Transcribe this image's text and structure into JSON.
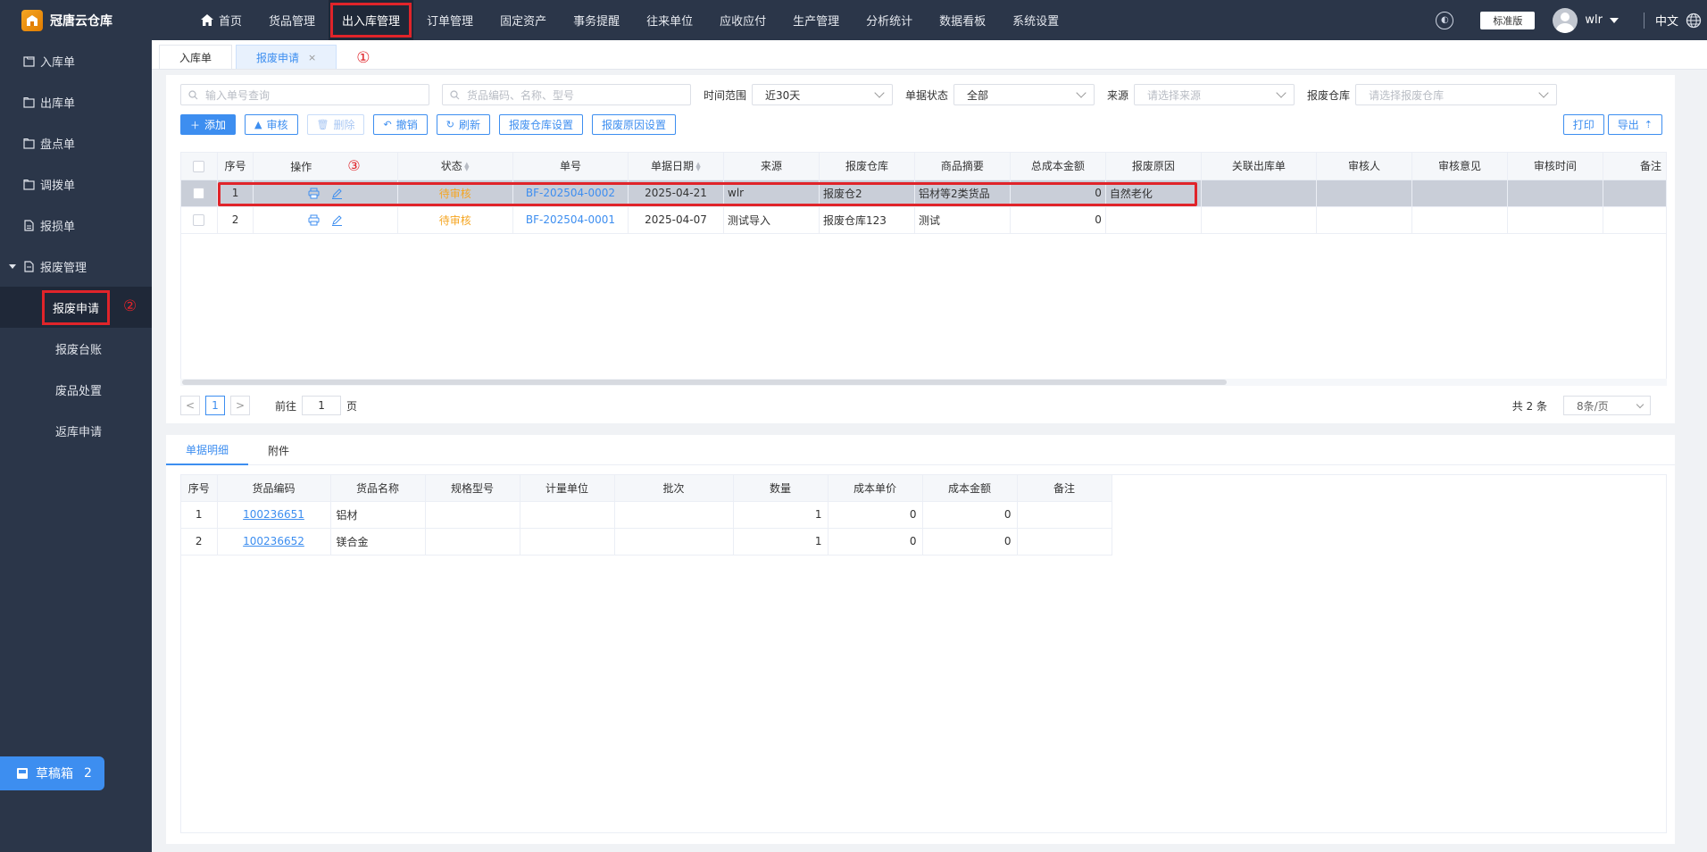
{
  "app": {
    "logo_text": "冠唐云仓库",
    "nav": [
      "首页",
      "货品管理",
      "出入库管理",
      "订单管理",
      "固定资产",
      "事务提醒",
      "往来单位",
      "应收应付",
      "生产管理",
      "分析统计",
      "数据看板",
      "系统设置"
    ],
    "edition": "标准版",
    "user": "wlr",
    "lang": "中文"
  },
  "sidebar": {
    "items": [
      "入库单",
      "出库单",
      "盘点单",
      "调拨单",
      "报损单"
    ],
    "group": "报废管理",
    "sub_items": [
      "报废申请",
      "报废台账",
      "废品处置",
      "返库申请"
    ],
    "draft_label": "草稿箱",
    "draft_count": "2"
  },
  "annotations": {
    "a1": "①",
    "a2": "②",
    "a3": "③"
  },
  "tabs": [
    {
      "label": "入库单"
    },
    {
      "label": "报废申请",
      "close": "×"
    }
  ],
  "filters": {
    "doc_search_ph": "输入单号查询",
    "goods_search_ph": "货品编码、名称、型号",
    "time_label": "时间范围",
    "time_value": "近30天",
    "status_label": "单据状态",
    "status_value": "全部",
    "source_label": "来源",
    "source_ph": "请选择来源",
    "warehouse_label": "报废仓库",
    "warehouse_ph": "请选择报废仓库"
  },
  "toolbar": {
    "add": "添加",
    "audit": "审核",
    "delete": "删除",
    "revoke": "撤销",
    "refresh": "刷新",
    "wh_settings": "报废仓库设置",
    "reason_settings": "报废原因设置",
    "print": "打印",
    "export": "导出"
  },
  "main_table": {
    "headers": [
      "序号",
      "操作",
      "状态",
      "单号",
      "单据日期",
      "来源",
      "报废仓库",
      "商品摘要",
      "总成本金额",
      "报废原因",
      "关联出库单",
      "审核人",
      "审核意见",
      "审核时间",
      "备注"
    ],
    "rows": [
      {
        "no": "1",
        "status": "待审核",
        "doc": "BF-202504-0002",
        "date": "2025-04-21",
        "source": "wlr",
        "warehouse": "报废仓2",
        "summary": "铝材等2类货品",
        "amount": "0",
        "reason": "自然老化"
      },
      {
        "no": "2",
        "status": "待审核",
        "doc": "BF-202504-0001",
        "date": "2025-04-07",
        "source": "测试导入",
        "warehouse": "报废仓库123",
        "summary": "测试",
        "amount": "0",
        "reason": ""
      }
    ]
  },
  "pager": {
    "prev": "<",
    "page": "1",
    "next": ">",
    "goto_pre": "前往",
    "goto_val": "1",
    "goto_post": "页",
    "total": "共 2 条",
    "size": "8条/页"
  },
  "detail": {
    "tabs": [
      "单据明细",
      "附件"
    ],
    "headers": [
      "序号",
      "货品编码",
      "货品名称",
      "规格型号",
      "计量单位",
      "批次",
      "数量",
      "成本单价",
      "成本金额",
      "备注"
    ],
    "rows": [
      {
        "no": "1",
        "code": "100236651",
        "name": "铝材",
        "qty": "1",
        "price": "0",
        "amount": "0"
      },
      {
        "no": "2",
        "code": "100236652",
        "name": "镁合金",
        "qty": "1",
        "price": "0",
        "amount": "0"
      }
    ]
  }
}
